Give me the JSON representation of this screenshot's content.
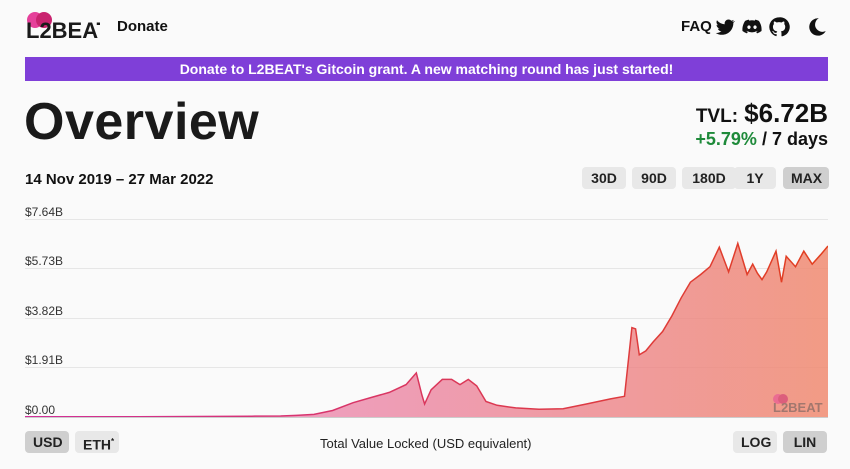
{
  "header": {
    "logo_text": "L2BEAT",
    "nav": {
      "donate": "Donate",
      "faq": "FAQ"
    },
    "icons": [
      "twitter-icon",
      "discord-icon",
      "github-icon",
      "dark-mode-icon"
    ]
  },
  "banner": {
    "text": "Donate to L2BEAT's Gitcoin grant. A new matching round has just started!"
  },
  "overview": {
    "title": "Overview",
    "tvl_label": "TVL:",
    "tvl_value": "$6.72B",
    "change_pct": "+5.79%",
    "change_period": "/ 7 days"
  },
  "chart_controls": {
    "date_range": "14 Nov 2019 – 27 Mar 2022",
    "periods": [
      "30D",
      "90D",
      "180D",
      "1Y",
      "MAX"
    ],
    "active_period": "MAX",
    "currency": [
      "USD",
      "ETH"
    ],
    "active_currency": "USD",
    "scale": [
      "LOG",
      "LIN"
    ],
    "active_scale": "LIN",
    "footer_label": "Total Value Locked (USD equivalent)"
  },
  "colors": {
    "accent": "#7f3fd8",
    "positive": "#1e8a3a",
    "line_start": "#d22e9a",
    "line_end": "#e23f1e"
  },
  "chart_data": {
    "type": "area",
    "title": "",
    "xlabel": "",
    "ylabel": "",
    "x_range": [
      "2019-11-14",
      "2022-03-27"
    ],
    "y_tick_labels": [
      "$7.64B",
      "$5.73B",
      "$3.82B",
      "$1.91B",
      "$0.00"
    ],
    "y_ticks": [
      7.64,
      5.73,
      3.82,
      1.91,
      0
    ],
    "ylim": [
      0,
      7.64
    ],
    "grid": true,
    "watermark": "L2BEAT",
    "series": [
      {
        "x": [
          "2019-11-14",
          "2020-01-15",
          "2020-03-15",
          "2020-05-15",
          "2020-07-15",
          "2020-08-15",
          "2020-09-01",
          "2020-09-20",
          "2020-10-10",
          "2020-11-01",
          "2020-11-20",
          "2020-12-10",
          "2020-12-28",
          "2021-01-08",
          "2021-01-14",
          "2021-01-17",
          "2021-01-24",
          "2021-02-05",
          "2021-02-15",
          "2021-02-24",
          "2021-03-05",
          "2021-03-14",
          "2021-03-24",
          "2021-04-05",
          "2021-04-25",
          "2021-05-20",
          "2021-06-15",
          "2021-07-10",
          "2021-08-05",
          "2021-08-20",
          "2021-08-28",
          "2021-09-01",
          "2021-09-05",
          "2021-09-12",
          "2021-09-20",
          "2021-09-30",
          "2021-10-10",
          "2021-10-20",
          "2021-10-30",
          "2021-11-10",
          "2021-11-20",
          "2021-11-30",
          "2021-12-10",
          "2021-12-20",
          "2021-12-30",
          "2022-01-05",
          "2022-01-10",
          "2022-01-15",
          "2022-01-20",
          "2022-01-30",
          "2022-02-05",
          "2022-02-10",
          "2022-02-20",
          "2022-03-01",
          "2022-03-10",
          "2022-03-20",
          "2022-03-27"
        ],
        "values": [
          0.01,
          0.01,
          0.01,
          0.02,
          0.03,
          0.04,
          0.06,
          0.1,
          0.25,
          0.55,
          0.75,
          0.95,
          1.25,
          1.7,
          0.85,
          0.5,
          1.05,
          1.45,
          1.45,
          1.25,
          1.45,
          1.2,
          0.6,
          0.45,
          0.35,
          0.3,
          0.32,
          0.5,
          0.7,
          0.8,
          3.45,
          3.4,
          2.4,
          2.55,
          2.9,
          3.3,
          3.9,
          4.6,
          5.2,
          5.5,
          5.8,
          6.55,
          5.6,
          6.7,
          5.5,
          5.9,
          5.55,
          5.3,
          5.6,
          6.4,
          5.2,
          6.2,
          5.8,
          6.4,
          5.9,
          6.3,
          6.6
        ]
      }
    ]
  }
}
